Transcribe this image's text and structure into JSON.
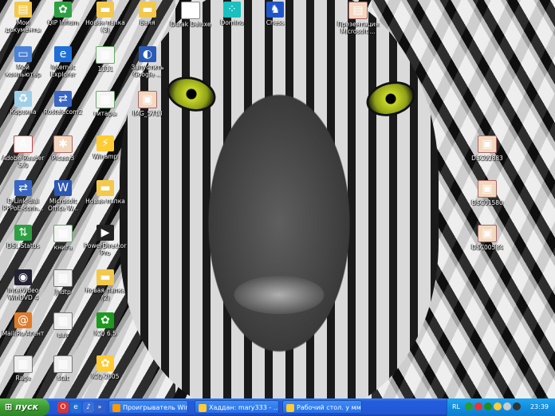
{
  "desktop_icons": [
    {
      "label": "Мои документы",
      "icon": "my-documents-icon"
    },
    {
      "label": "QIP Infium",
      "icon": "qip-icon"
    },
    {
      "label": "Новая папка (3)",
      "icon": "folder-icon"
    },
    {
      "label": "Баня",
      "icon": "folder-icon"
    },
    {
      "label": "Durak Deluxe",
      "icon": "cards-icon"
    },
    {
      "label": "Domino",
      "icon": "domino-icon"
    },
    {
      "label": "Chess",
      "icon": "chess-icon"
    },
    {
      "label": "Презентация Microsoft ...",
      "icon": "presentation-icon"
    },
    {
      "label": "Мой компьютер",
      "icon": "my-computer-icon"
    },
    {
      "label": "Internet Explorer",
      "icon": "ie-icon"
    },
    {
      "label": "1111",
      "icon": "spreadsheet-icon"
    },
    {
      "label": "Запустить Google ...",
      "icon": "google-icon"
    },
    {
      "label": "Корзина",
      "icon": "recycle-bin-icon"
    },
    {
      "label": "Rostelecom2",
      "icon": "network-icon"
    },
    {
      "label": "гитары",
      "icon": "spreadsheet-icon"
    },
    {
      "label": "IMG_5713",
      "icon": "image-icon"
    },
    {
      "label": "Adobe Reader 5.0",
      "icon": "pdf-icon"
    },
    {
      "label": "Picasa3",
      "icon": "picasa-icon"
    },
    {
      "label": "Winamp",
      "icon": "winamp-icon"
    },
    {
      "label": "DSC02883",
      "icon": "image-icon"
    },
    {
      "label": "D-Link dial PPPoE-conn...",
      "icon": "network-icon"
    },
    {
      "label": "Microsoft Office W...",
      "icon": "word-icon"
    },
    {
      "label": "Новая папка",
      "icon": "folder-icon"
    },
    {
      "label": "DSC01580",
      "icon": "image-icon"
    },
    {
      "label": "DSL Status",
      "icon": "dsl-status-icon"
    },
    {
      "label": "книга",
      "icon": "spreadsheet-icon"
    },
    {
      "label": "PowerDirector Pro",
      "icon": "powerdirector-icon"
    },
    {
      "label": "DSC00584",
      "icon": "image-icon"
    },
    {
      "label": "InterVideo WinDVD 4",
      "icon": "dvd-icon"
    },
    {
      "label": "Jhdtp",
      "icon": "screenshot-icon"
    },
    {
      "label": "Новая папка (2)",
      "icon": "folder-icon"
    },
    {
      "label": "Mail.Ru Агент",
      "icon": "mail-agent-icon"
    },
    {
      "label": "вал",
      "icon": "screenshot-icon"
    },
    {
      "label": "ICQ 6.5",
      "icon": "icq-icon"
    },
    {
      "label": "Rage",
      "icon": "screenshot-icon"
    },
    {
      "label": "stat",
      "icon": "screenshot-icon"
    },
    {
      "label": "ICQ 2005",
      "icon": "icq-old-icon"
    }
  ],
  "taskbar": {
    "start_label": "пуск",
    "tasks": [
      {
        "label": "Проигрыватель Win...",
        "icon": "media-player-icon"
      },
      {
        "label": "Хаддан: mary333 - ...",
        "icon": "window-icon"
      },
      {
        "label": "Рабочий стол. у ммм...",
        "icon": "window-icon"
      }
    ],
    "tray": {
      "language": "RL",
      "clock": "23:39"
    }
  }
}
